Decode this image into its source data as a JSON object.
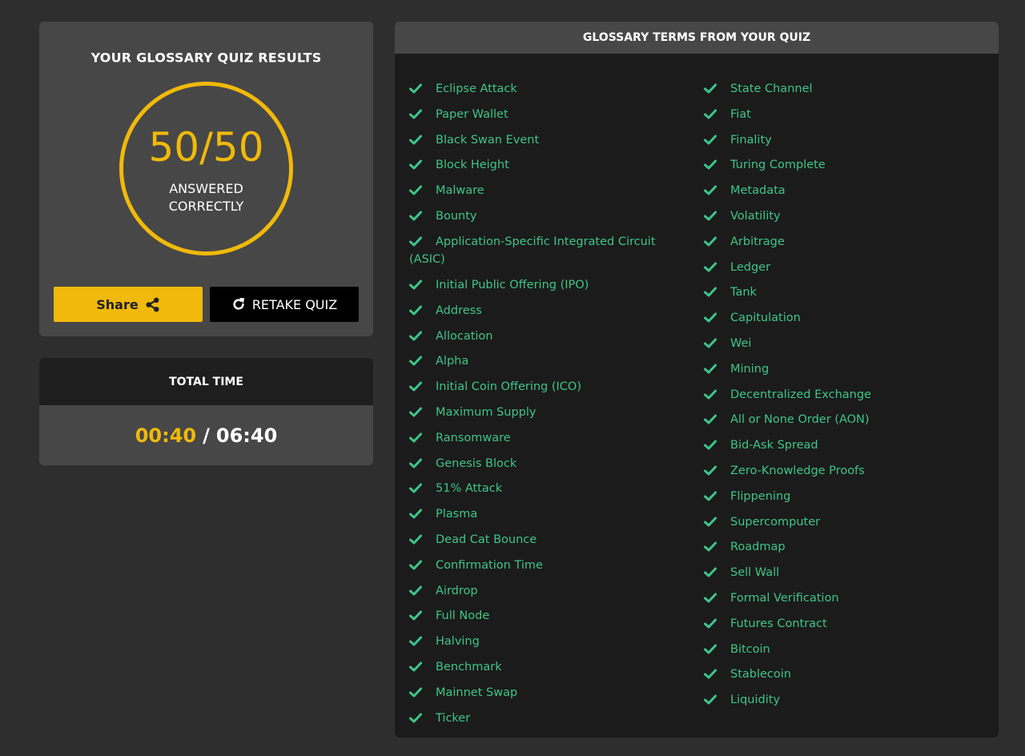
{
  "results": {
    "title": "YOUR GLOSSARY QUIZ RESULTS",
    "score": "50/50",
    "caption": "ANSWERED\nCORRECTLY",
    "share_label": "Share",
    "retake_label": "RETAKE QUIZ"
  },
  "time": {
    "title": "TOTAL TIME",
    "elapsed": "00:40",
    "separator": "/",
    "total": "06:40"
  },
  "terms": {
    "title": "GLOSSARY TERMS FROM YOUR QUIZ",
    "left": [
      "Eclipse Attack",
      "Paper Wallet",
      "Black Swan Event",
      "Block Height",
      "Malware",
      "Bounty",
      "Application-Specific Integrated Circuit (ASIC)",
      "Initial Public Offering (IPO)",
      "Address",
      "Allocation",
      "Alpha",
      "Initial Coin Offering (ICO)",
      "Maximum Supply",
      "Ransomware",
      "Genesis Block",
      "51% Attack",
      "Plasma",
      "Dead Cat Bounce",
      "Confirmation Time",
      "Airdrop",
      "Full Node",
      "Halving",
      "Benchmark",
      "Mainnet Swap",
      "Ticker"
    ],
    "right": [
      "State Channel",
      "Fiat",
      "Finality",
      "Turing Complete",
      "Metadata",
      "Volatility",
      "Arbitrage",
      "Ledger",
      "Tank",
      "Capitulation",
      "Wei",
      "Mining",
      "Decentralized Exchange",
      "All or None Order (AON)",
      "Bid-Ask Spread",
      "Zero-Knowledge Proofs",
      "Flippening",
      "Supercomputer",
      "Roadmap",
      "Sell Wall",
      "Formal Verification",
      "Futures Contract",
      "Bitcoin",
      "Stablecoin",
      "Liquidity"
    ]
  },
  "colors": {
    "accent": "#f0b90b",
    "check": "#3fc58a",
    "page_bg": "#2e2e2e",
    "card_bg": "#474747",
    "terms_bg": "#1b1b1b"
  },
  "icons": {
    "share": "share-icon",
    "retake": "refresh-icon",
    "term": "check-icon"
  }
}
